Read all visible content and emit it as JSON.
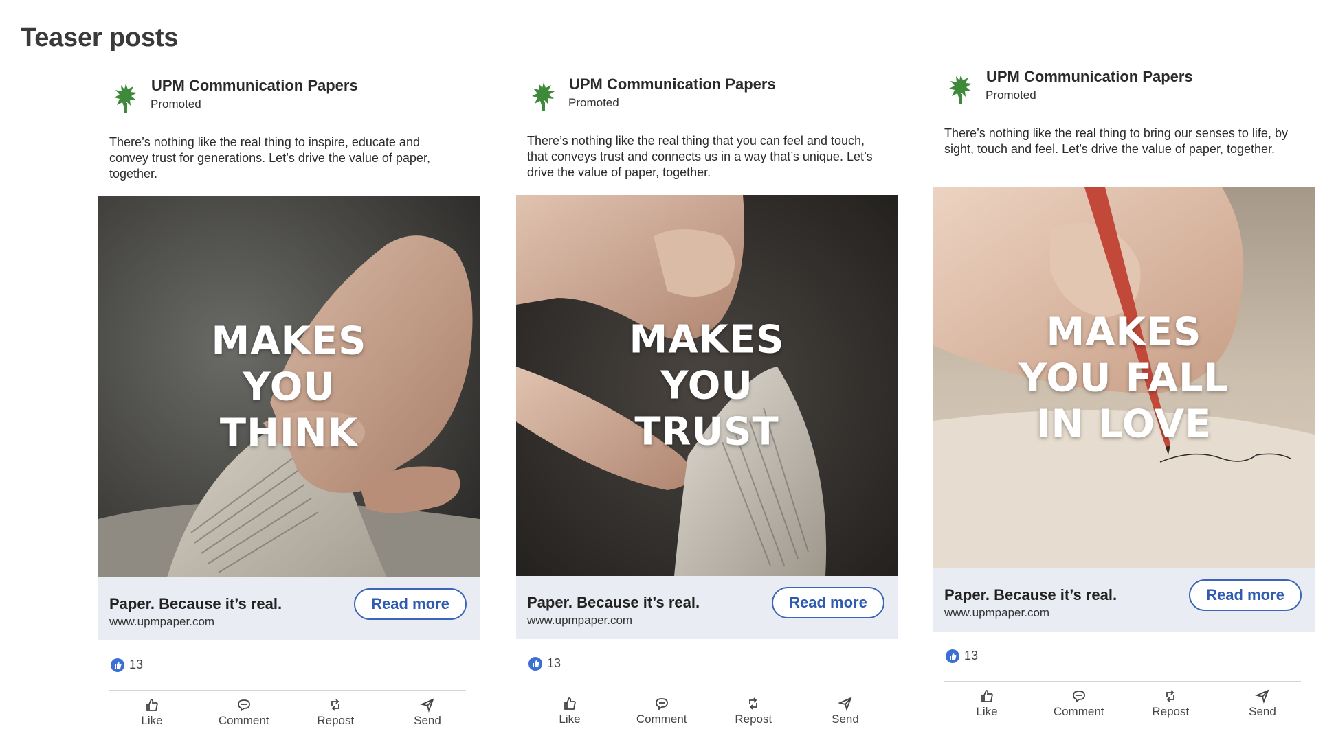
{
  "page": {
    "heading": "Teaser posts"
  },
  "colors": {
    "accent": "#2f5bb0",
    "cta_bar_bg": "#e9ecf2",
    "logo_green": "#3f8a3a",
    "like_blue": "#3b6fd4"
  },
  "posts": [
    {
      "company": "UPM Communication Papers",
      "promoted": "Promoted",
      "text": "There’s nothing like the real thing to inspire, educate and convey trust for generations. Let’s drive the value of paper, together.",
      "image_lines": [
        "MAKES",
        "YOU",
        "THINK"
      ],
      "cta_title": "Paper. Because it’s real.",
      "cta_url": "www.upmpaper.com",
      "cta_button": "Read more",
      "reaction_count": "13",
      "actions": {
        "like": "Like",
        "comment": "Comment",
        "repost": "Repost",
        "send": "Send"
      }
    },
    {
      "company": "UPM Communication Papers",
      "promoted": "Promoted",
      "text": "There’s nothing like the real thing that you can feel and touch, that conveys trust and connects us in a way that’s unique. Let’s drive the value of paper, together.",
      "image_lines": [
        "MAKES",
        "YOU",
        "TRUST"
      ],
      "cta_title": "Paper. Because it’s real.",
      "cta_url": "www.upmpaper.com",
      "cta_button": "Read more",
      "reaction_count": "13",
      "actions": {
        "like": "Like",
        "comment": "Comment",
        "repost": "Repost",
        "send": "Send"
      }
    },
    {
      "company": "UPM Communication Papers",
      "promoted": "Promoted",
      "text": "There’s nothing like the real thing to bring our senses to life, by sight, touch and feel. Let’s drive the value of paper, together.",
      "image_lines": [
        "MAKES",
        "YOU FALL",
        "IN LOVE"
      ],
      "cta_title": "Paper. Because it’s real.",
      "cta_url": "www.upmpaper.com",
      "cta_button": "Read more",
      "reaction_count": "13",
      "actions": {
        "like": "Like",
        "comment": "Comment",
        "repost": "Repost",
        "send": "Send"
      }
    }
  ]
}
